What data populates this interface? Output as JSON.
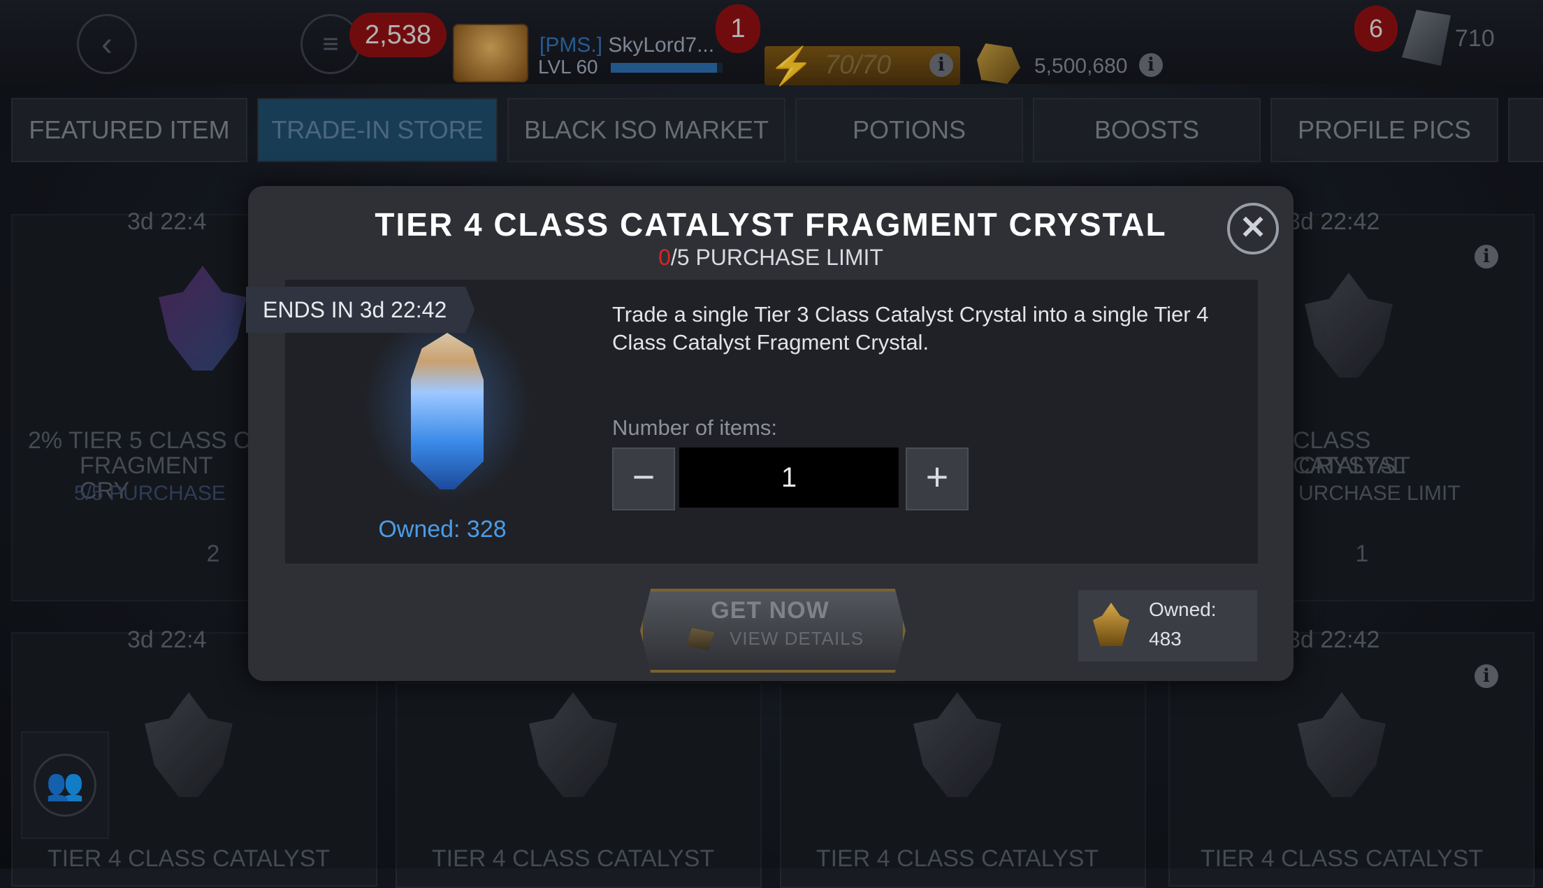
{
  "topbar": {
    "rating": "2,538",
    "alerts_count": "1",
    "player_alliance": "[PMS.]",
    "player_name": "SkyLord7...",
    "player_level": "LVL 60",
    "xp_fraction": 0.95,
    "energy": "70/70",
    "gold": "5,500,680",
    "messages_count": "6",
    "units": "710"
  },
  "tabs": [
    {
      "label": "FEATURED ITEM"
    },
    {
      "label": "TRADE-IN STORE"
    },
    {
      "label": "BLACK ISO MARKET"
    },
    {
      "label": "POTIONS"
    },
    {
      "label": "BOOSTS"
    },
    {
      "label": "PROFILE PICS"
    }
  ],
  "background_cards": {
    "timer": "3d 22:4",
    "timer_full": "3d 22:42",
    "left_top_title": "2% TIER 5 CLASS C",
    "left_top_title2": "FRAGMENT CRY",
    "left_top_limit": "5/5 PURCHASE",
    "left_top_cost": "2",
    "right_top_title": "CLASS CATALYST",
    "right_top_title2": "CRYSTAL",
    "right_top_limit": "URCHASE LIMIT",
    "right_top_cost": "1",
    "bottom_title": "TIER 4 CLASS CATALYST"
  },
  "modal": {
    "title": "TIER 4 CLASS CATALYST FRAGMENT CRYSTAL",
    "limit_used": "0",
    "limit_rest": "/5 PURCHASE LIMIT",
    "ends_in": "ENDS IN 3d 22:42",
    "item_owned": "Owned: 328",
    "description": "Trade a single Tier 3 Class Catalyst Crystal into a single Tier 4 Class Catalyst Fragment Crystal.",
    "quantity_label": "Number of items:",
    "quantity_value": "1",
    "minus_symbol": "−",
    "plus_symbol": "+",
    "get_now_label": "GET NOW",
    "view_details_label": "VIEW DETAILS",
    "currency_owned_label": "Owned:",
    "currency_owned_value": "483",
    "close_symbol": "✕"
  },
  "icons": {
    "back": "chevron-left-icon",
    "menu": "menu-icon",
    "energy": "lightning-icon",
    "gold": "gold-icon",
    "units": "units-icon",
    "close": "close-icon",
    "alliance": "alliance-icon"
  },
  "colors": {
    "limit_used": "#d42828",
    "owned_blue": "#4c9be8",
    "active_tab": "#1f4a68"
  }
}
